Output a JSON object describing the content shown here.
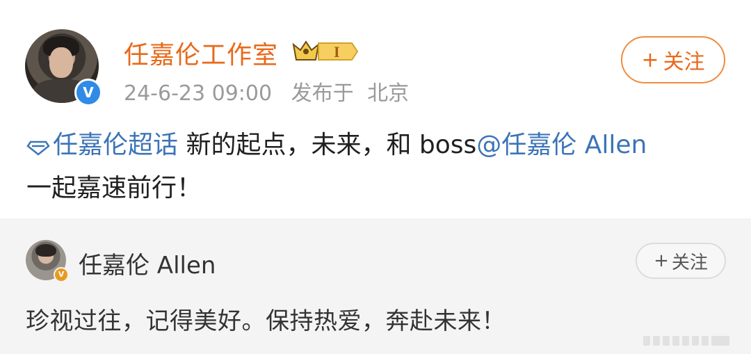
{
  "post": {
    "author": "任嘉伦工作室",
    "timestamp": "24-6-23 09:00",
    "published_label": "发布于",
    "location": "北京",
    "follow_label": "关注",
    "follow_symbol": "+",
    "vip_level": "I",
    "topic": "任嘉伦超话",
    "content_before_mention": " 新的起点，未来，和 boss",
    "mention": "@任嘉伦 Allen",
    "content_after_mention": "一起嘉速前行！"
  },
  "repost": {
    "author": "任嘉伦 Allen",
    "follow_label": "关注",
    "follow_symbol": "+",
    "text": "珍视过往，记得美好。保持热爱，奔赴未来！"
  },
  "colors": {
    "author_orange": "#e8691a",
    "link_blue": "#3c74b7",
    "verified_blue": "#2f8be6",
    "verified_gold": "#e89a1f",
    "repost_bg": "#f4f4f4"
  },
  "icons": {
    "verified_main": "verified-v-icon",
    "verified_small": "verified-v-gold-icon",
    "vip": "crown-vip-badge-icon",
    "topic": "topic-diamond-icon"
  }
}
